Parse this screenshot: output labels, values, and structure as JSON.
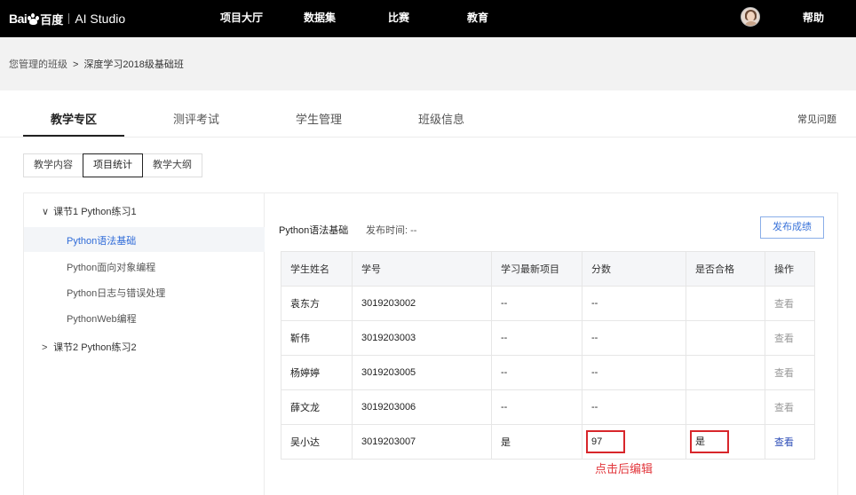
{
  "topbar": {
    "logo_bai": "Bai",
    "logo_cn": "百度",
    "logo_studio": "AI Studio",
    "nav": [
      "项目大厅",
      "数据集",
      "比赛",
      "教育"
    ],
    "help": "帮助",
    "avatar_icon": "user-avatar"
  },
  "breadcrumb": {
    "parent": "您管理的班级",
    "separator": ">",
    "current": "深度学习2018级基础班"
  },
  "tabs": [
    "教学专区",
    "测评考试",
    "学生管理",
    "班级信息"
  ],
  "faq": "常见问题",
  "subtabs": [
    "教学内容",
    "项目统计",
    "教学大纲"
  ],
  "tree": {
    "section1": "课节1 Python练习1",
    "items": [
      "Python语法基础",
      "Python面向对象编程",
      "Python日志与错误处理",
      "PythonWeb编程"
    ],
    "section2": "课节2 Python练习2"
  },
  "panel": {
    "course_title": "Python语法基础",
    "publish_time": "发布时间: --",
    "publish_button": "发布成绩"
  },
  "table": {
    "headers": [
      "学生姓名",
      "学号",
      "学习最新项目",
      "分数",
      "是否合格",
      "操作"
    ],
    "rows": [
      {
        "name": "袁东方",
        "id": "3019203002",
        "latest": "--",
        "score": "--",
        "pass": "",
        "op": "查看"
      },
      {
        "name": "靳伟",
        "id": "3019203003",
        "latest": "--",
        "score": "--",
        "pass": "",
        "op": "查看"
      },
      {
        "name": "杨婷婷",
        "id": "3019203005",
        "latest": "--",
        "score": "--",
        "pass": "",
        "op": "查看"
      },
      {
        "name": "薛文龙",
        "id": "3019203006",
        "latest": "--",
        "score": "--",
        "pass": "",
        "op": "查看"
      },
      {
        "name": "吴小达",
        "id": "3019203007",
        "latest": "是",
        "score": "97",
        "pass": "是",
        "op": "查看"
      }
    ]
  },
  "edit_hint": "点击后编辑",
  "colors": {
    "topbar": "#000000",
    "link_blue": "#2f6bd8",
    "highlight_red": "#d8262b"
  }
}
